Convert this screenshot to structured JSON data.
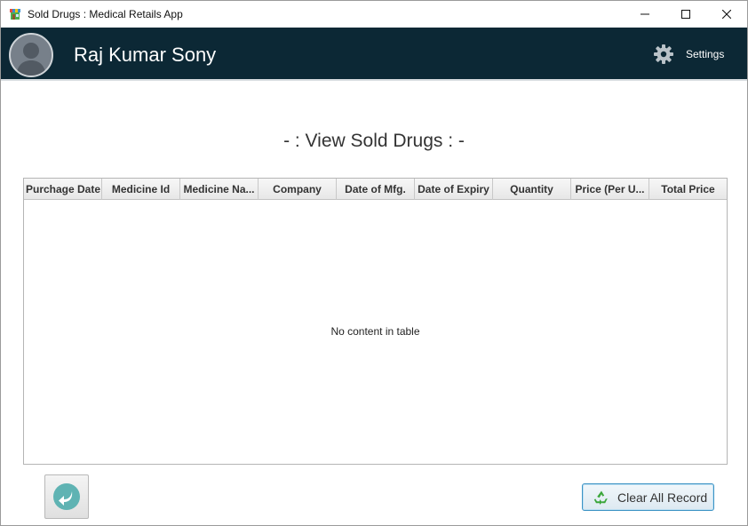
{
  "window": {
    "title": "Sold Drugs : Medical Retails App",
    "controls": {
      "minimize": "minimize-icon",
      "maximize": "maximize-icon",
      "close": "close-icon"
    }
  },
  "header": {
    "user_name": "Raj Kumar Sony",
    "settings_label": "Settings",
    "background_color": "#0c2835"
  },
  "page": {
    "heading": "- : View Sold Drugs : -"
  },
  "table": {
    "columns": [
      "Purchage Date",
      "Medicine Id",
      "Medicine Na...",
      "Company",
      "Date of Mfg.",
      "Date of Expiry",
      "Quantity",
      "Price  (Per U...",
      "Total Price"
    ],
    "rows": [],
    "empty_message": "No content in table"
  },
  "actions": {
    "back_icon": "back-arrow-icon",
    "clear_label": "Clear All Record",
    "clear_icon": "recycle-icon",
    "accent_color": "#3c93c4"
  }
}
